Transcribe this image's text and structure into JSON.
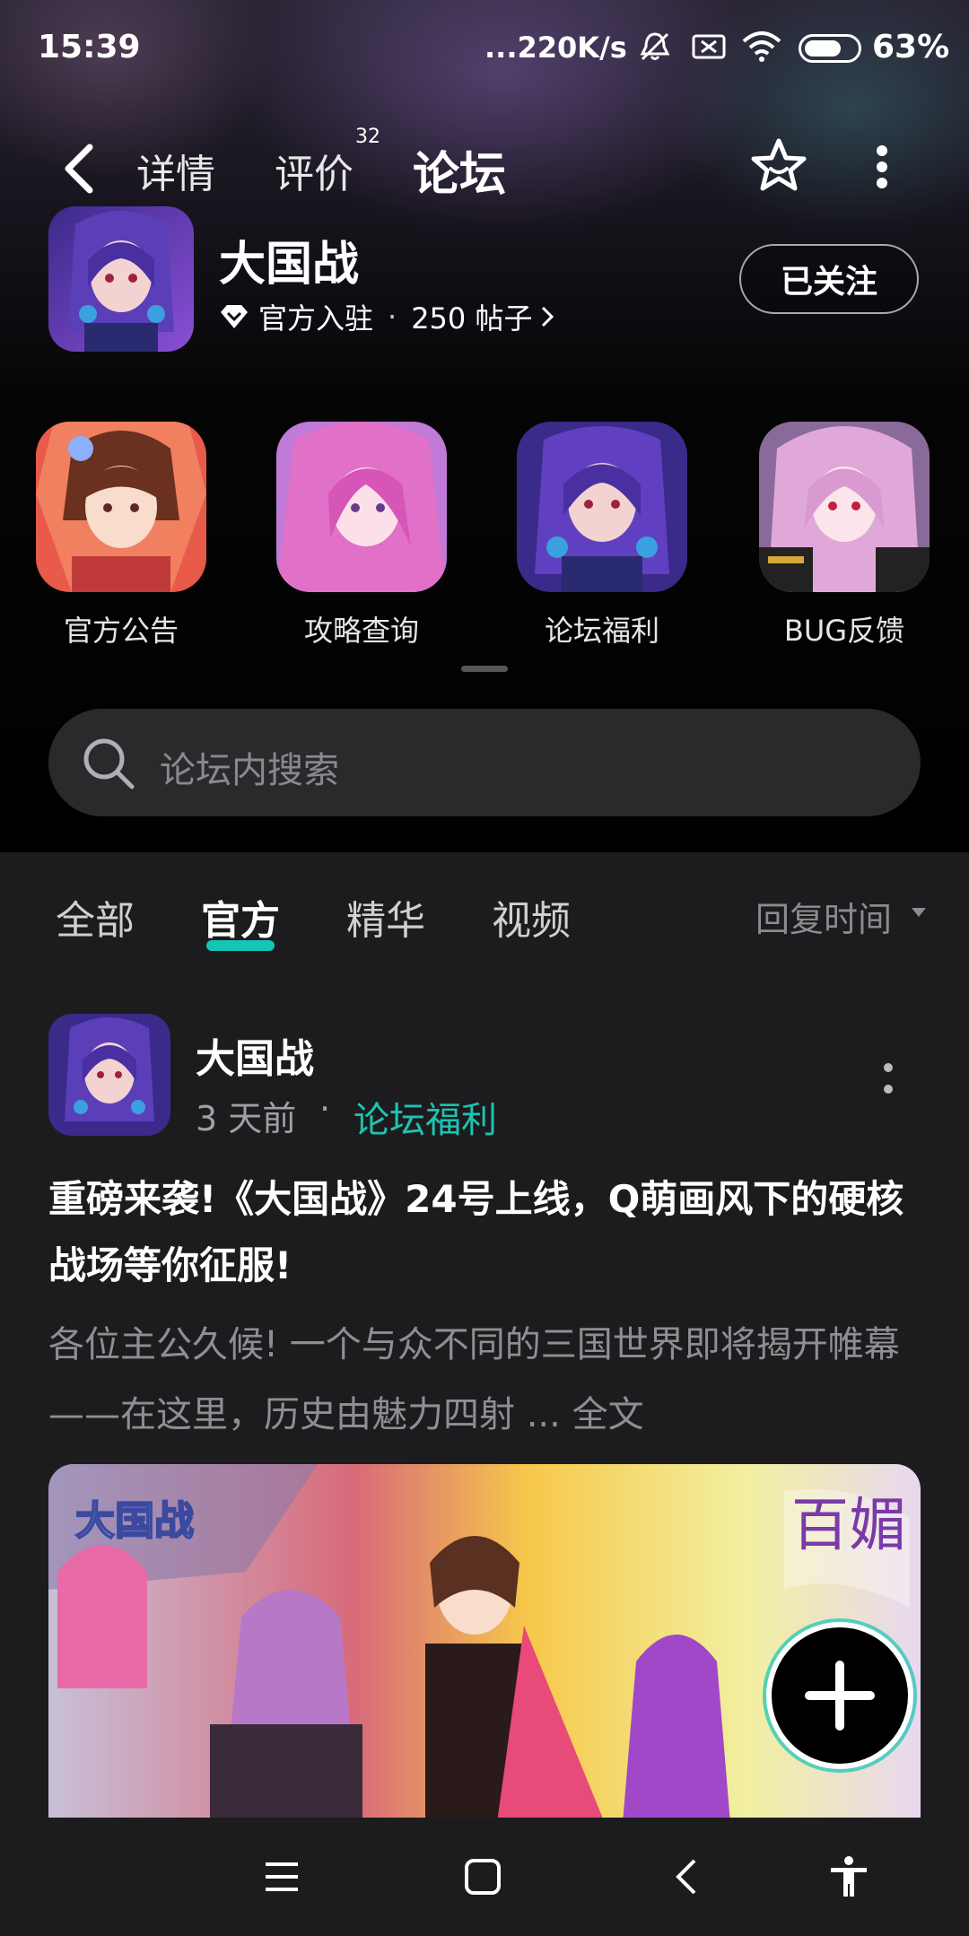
{
  "status_bar": {
    "time": "15:39",
    "net_speed": "...220K/s",
    "battery_pct": "63%"
  },
  "nav": {
    "tabs": [
      {
        "label": "详情"
      },
      {
        "label": "评价",
        "badge": "32"
      },
      {
        "label": "论坛"
      }
    ],
    "active_tab": "论坛"
  },
  "app": {
    "name": "大国战",
    "verified_label": "官方入驻",
    "posts": "250 帖子",
    "follow_label": "已关注"
  },
  "quick_links": [
    {
      "label": "官方公告"
    },
    {
      "label": "攻略查询"
    },
    {
      "label": "论坛福利"
    },
    {
      "label": "BUG反馈"
    }
  ],
  "search": {
    "placeholder": "论坛内搜索"
  },
  "filters": {
    "tabs": [
      {
        "label": "全部"
      },
      {
        "label": "官方"
      },
      {
        "label": "精华"
      },
      {
        "label": "视频"
      }
    ],
    "active": "官方",
    "sort_label": "回复时间"
  },
  "post": {
    "author": "大国战",
    "time": "3 天前",
    "separator": "·",
    "category": "论坛福利",
    "title": "重磅来袭!《大国战》24号上线，Q萌画风下的硬核战场等你征服!",
    "body": "各位主公久候! 一个与众不同的三国世界即将揭开帷幕——在这里，历史由魅力四射",
    "more_link": "... 全文"
  },
  "colors": {
    "accent": "#14c5b6",
    "category_text": "#1ec3b2",
    "background": "#1c1c1e"
  }
}
